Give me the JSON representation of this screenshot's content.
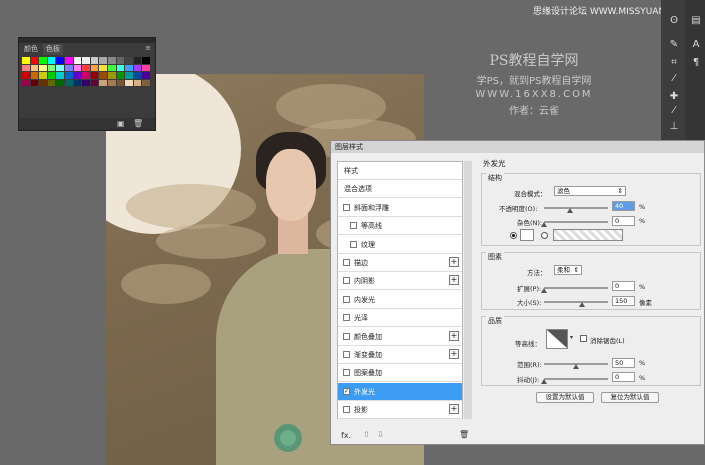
{
  "watermark_top": "思缘设计论坛 WWW.MISSYUAN.COM",
  "watermark": {
    "line1": "PS教程自学网",
    "line2": "学PS，就到PS教程自学网",
    "line3": "WWW.16XX8.COM",
    "line4": "作者：云雀"
  },
  "swatch_panel": {
    "tab1": "颜色",
    "tab2": "色板",
    "colors": [
      "#ffff00",
      "#ff0000",
      "#00ff00",
      "#00ffff",
      "#0000ff",
      "#ff00ff",
      "#ffffff",
      "#eeeeee",
      "#cccccc",
      "#aaaaaa",
      "#888888",
      "#666666",
      "#444444",
      "#222222",
      "#000000",
      "#ff7f7f",
      "#ffbf7f",
      "#ffff7f",
      "#7fff7f",
      "#7fffff",
      "#7f7fff",
      "#ff7fff",
      "#ff3f3f",
      "#ff9f3f",
      "#ffdf3f",
      "#3fff3f",
      "#3fffdf",
      "#3f9fff",
      "#9f3fff",
      "#ff3f9f",
      "#cc0000",
      "#cc6600",
      "#cccc00",
      "#00cc00",
      "#00cccc",
      "#0066cc",
      "#6600cc",
      "#cc0066",
      "#990000",
      "#994c00",
      "#999900",
      "#009900",
      "#009999",
      "#004c99",
      "#4c0099",
      "#99004c",
      "#660000",
      "#663300",
      "#666600",
      "#006600",
      "#006666",
      "#003366",
      "#330066",
      "#660033",
      "#c8a27a",
      "#a47a52",
      "#7a5636",
      "#f0d8b8",
      "#d8b088",
      "#806040"
    ]
  },
  "dialog": {
    "title": "图层样式",
    "list": [
      {
        "label": "样式",
        "has_checkbox": false,
        "has_plus": false,
        "selected": false
      },
      {
        "label": "混合选项",
        "has_checkbox": false,
        "has_plus": false,
        "selected": false
      },
      {
        "label": "斜面和浮雕",
        "has_checkbox": true,
        "has_plus": false,
        "selected": false
      },
      {
        "label": "等高线",
        "has_checkbox": true,
        "has_plus": false,
        "selected": false,
        "indent": true
      },
      {
        "label": "纹理",
        "has_checkbox": true,
        "has_plus": false,
        "selected": false,
        "indent": true
      },
      {
        "label": "描边",
        "has_checkbox": true,
        "has_plus": true,
        "selected": false
      },
      {
        "label": "内阴影",
        "has_checkbox": true,
        "has_plus": true,
        "selected": false
      },
      {
        "label": "内发光",
        "has_checkbox": true,
        "has_plus": false,
        "selected": false
      },
      {
        "label": "光泽",
        "has_checkbox": true,
        "has_plus": false,
        "selected": false
      },
      {
        "label": "颜色叠加",
        "has_checkbox": true,
        "has_plus": true,
        "selected": false
      },
      {
        "label": "渐变叠加",
        "has_checkbox": true,
        "has_plus": true,
        "selected": false
      },
      {
        "label": "图案叠加",
        "has_checkbox": true,
        "has_plus": false,
        "selected": false
      },
      {
        "label": "外发光",
        "has_checkbox": true,
        "has_plus": false,
        "selected": true,
        "checked": true
      },
      {
        "label": "投影",
        "has_checkbox": true,
        "has_plus": true,
        "selected": false
      }
    ],
    "footer_fx": "fx.",
    "heading": "外发光",
    "structure": {
      "title": "结构",
      "blend_label": "混合模式：",
      "blend_value": "滤色",
      "opacity_label": "不透明度(O):",
      "opacity_value": "40",
      "opacity_unit": "%",
      "opacity_fraction": 0.4,
      "noise_label": "杂色(N):",
      "noise_value": "0",
      "noise_unit": "%",
      "noise_fraction": 0.0
    },
    "elements": {
      "title": "图素",
      "method_label": "方法：",
      "method_value": "柔和",
      "spread_label": "扩展(P):",
      "spread_value": "0",
      "spread_unit": "%",
      "spread_fraction": 0.0,
      "size_label": "大小(S):",
      "size_value": "150",
      "size_unit": "像素",
      "size_fraction": 0.6
    },
    "quality": {
      "title": "品质",
      "contour_label": "等高线：",
      "antialias_label": "消除锯齿(L)",
      "range_label": "范围(R):",
      "range_value": "50",
      "range_unit": "%",
      "range_fraction": 0.5,
      "jitter_label": "抖动(J):",
      "jitter_value": "0",
      "jitter_unit": "%",
      "jitter_fraction": 0.0
    },
    "btn_default": "设置为默认值",
    "btn_reset": "复位为默认值"
  }
}
